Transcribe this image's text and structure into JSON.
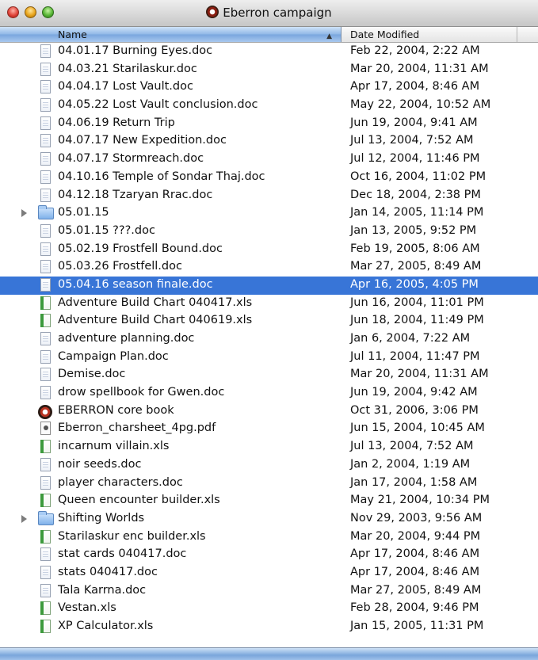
{
  "window": {
    "title": "Eberron campaign",
    "title_icon": "eberron-book-icon"
  },
  "columns": {
    "name": "Name",
    "date_modified": "Date Modified",
    "sort_icon": "sort-ascending-icon"
  },
  "colors": {
    "selection": "#3875d7",
    "header_sorted": "#8fb7e6"
  },
  "files": [
    {
      "name": "04.01.17 Burning Eyes.doc",
      "date": "Feb 22, 2004, 2:22 AM",
      "icon": "doc",
      "folder": false,
      "selected": false
    },
    {
      "name": "04.03.21 Starilaskur.doc",
      "date": "Mar 20, 2004, 11:31 AM",
      "icon": "doc",
      "folder": false,
      "selected": false
    },
    {
      "name": "04.04.17 Lost Vault.doc",
      "date": "Apr 17, 2004, 8:46 AM",
      "icon": "doc",
      "folder": false,
      "selected": false
    },
    {
      "name": "04.05.22 Lost Vault conclusion.doc",
      "date": "May 22, 2004, 10:52 AM",
      "icon": "doc",
      "folder": false,
      "selected": false
    },
    {
      "name": "04.06.19 Return Trip",
      "date": "Jun 19, 2004, 9:41 AM",
      "icon": "doc",
      "folder": false,
      "selected": false
    },
    {
      "name": "04.07.17 New Expedition.doc",
      "date": "Jul 13, 2004, 7:52 AM",
      "icon": "doc",
      "folder": false,
      "selected": false
    },
    {
      "name": "04.07.17 Stormreach.doc",
      "date": "Jul 12, 2004, 11:46 PM",
      "icon": "doc",
      "folder": false,
      "selected": false
    },
    {
      "name": "04.10.16 Temple of Sondar Thaj.doc",
      "date": "Oct 16, 2004, 11:02 PM",
      "icon": "doc",
      "folder": false,
      "selected": false
    },
    {
      "name": "04.12.18 Tzaryan Rrac.doc",
      "date": "Dec 18, 2004, 2:38 PM",
      "icon": "doc",
      "folder": false,
      "selected": false
    },
    {
      "name": "05.01.15",
      "date": "Jan 14, 2005, 11:14 PM",
      "icon": "folder",
      "folder": true,
      "selected": false
    },
    {
      "name": "05.01.15 ???.doc",
      "date": "Jan 13, 2005, 9:52 PM",
      "icon": "doc",
      "folder": false,
      "selected": false
    },
    {
      "name": "05.02.19 Frostfell Bound.doc",
      "date": "Feb 19, 2005, 8:06 AM",
      "icon": "doc",
      "folder": false,
      "selected": false
    },
    {
      "name": "05.03.26 Frostfell.doc",
      "date": "Mar 27, 2005, 8:49 AM",
      "icon": "doc",
      "folder": false,
      "selected": false
    },
    {
      "name": "05.04.16 season finale.doc",
      "date": "Apr 16, 2005, 4:05 PM",
      "icon": "doc",
      "folder": false,
      "selected": true
    },
    {
      "name": "Adventure Build Chart 040417.xls",
      "date": "Jun 16, 2004, 11:01 PM",
      "icon": "xls",
      "folder": false,
      "selected": false
    },
    {
      "name": "Adventure Build Chart 040619.xls",
      "date": "Jun 18, 2004, 11:49 PM",
      "icon": "xls",
      "folder": false,
      "selected": false
    },
    {
      "name": "adventure planning.doc",
      "date": "Jan 6, 2004, 7:22 AM",
      "icon": "doc",
      "folder": false,
      "selected": false
    },
    {
      "name": "Campaign Plan.doc",
      "date": "Jul 11, 2004, 11:47 PM",
      "icon": "doc",
      "folder": false,
      "selected": false
    },
    {
      "name": "Demise.doc",
      "date": "Mar 20, 2004, 11:31 AM",
      "icon": "doc",
      "folder": false,
      "selected": false
    },
    {
      "name": "drow spellbook for Gwen.doc",
      "date": "Jun 19, 2004, 9:42 AM",
      "icon": "doc",
      "folder": false,
      "selected": false
    },
    {
      "name": "EBERRON core book",
      "date": "Oct 31, 2006, 3:06 PM",
      "icon": "app",
      "folder": false,
      "selected": false
    },
    {
      "name": "Eberron_charsheet_4pg.pdf",
      "date": "Jun 15, 2004, 10:45 AM",
      "icon": "pdf",
      "folder": false,
      "selected": false
    },
    {
      "name": "incarnum villain.xls",
      "date": "Jul 13, 2004, 7:52 AM",
      "icon": "xls",
      "folder": false,
      "selected": false
    },
    {
      "name": "noir seeds.doc",
      "date": "Jan 2, 2004, 1:19 AM",
      "icon": "doc",
      "folder": false,
      "selected": false
    },
    {
      "name": "player characters.doc",
      "date": "Jan 17, 2004, 1:58 AM",
      "icon": "doc",
      "folder": false,
      "selected": false
    },
    {
      "name": "Queen encounter builder.xls",
      "date": "May 21, 2004, 10:34 PM",
      "icon": "xls",
      "folder": false,
      "selected": false
    },
    {
      "name": "Shifting Worlds",
      "date": "Nov 29, 2003, 9:56 AM",
      "icon": "folder",
      "folder": true,
      "selected": false
    },
    {
      "name": "Starilaskur enc builder.xls",
      "date": "Mar 20, 2004, 9:44 PM",
      "icon": "xls",
      "folder": false,
      "selected": false
    },
    {
      "name": "stat cards 040417.doc",
      "date": "Apr 17, 2004, 8:46 AM",
      "icon": "doc",
      "folder": false,
      "selected": false
    },
    {
      "name": "stats 040417.doc",
      "date": "Apr 17, 2004, 8:46 AM",
      "icon": "doc",
      "folder": false,
      "selected": false
    },
    {
      "name": "Tala Karrna.doc",
      "date": "Mar 27, 2005, 8:49 AM",
      "icon": "doc",
      "folder": false,
      "selected": false
    },
    {
      "name": "Vestan.xls",
      "date": "Feb 28, 2004, 9:46 PM",
      "icon": "xls",
      "folder": false,
      "selected": false
    },
    {
      "name": "XP Calculator.xls",
      "date": "Jan 15, 2005, 11:31 PM",
      "icon": "xls",
      "folder": false,
      "selected": false
    }
  ]
}
